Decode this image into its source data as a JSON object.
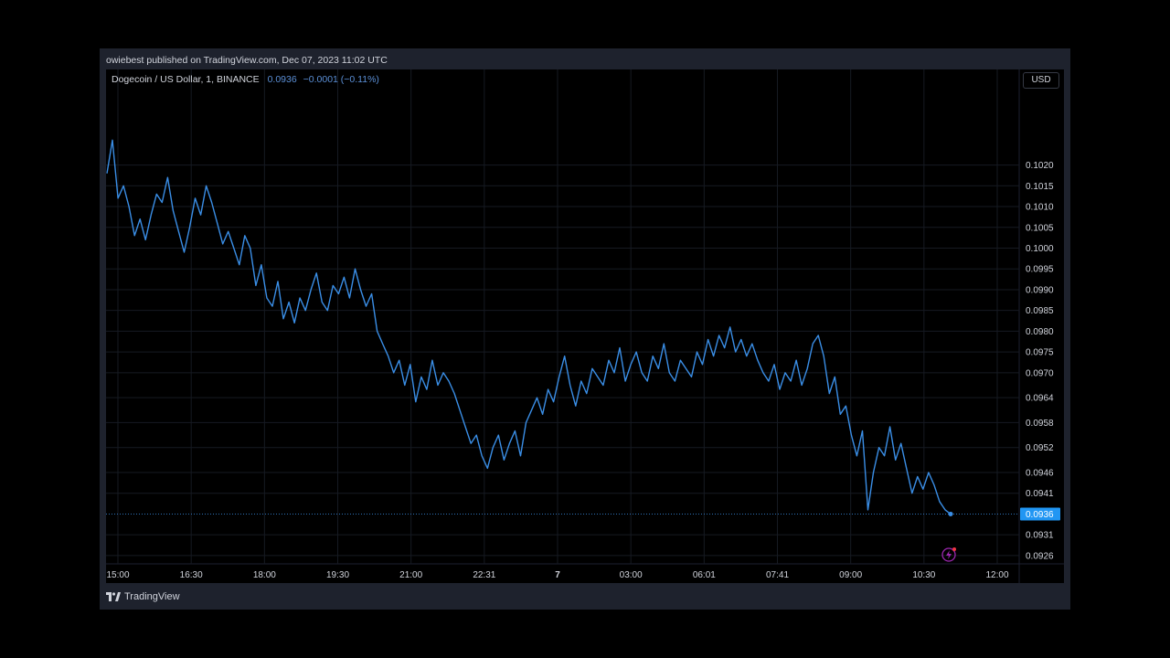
{
  "header": {
    "published": "owiebest published on TradingView.com, Dec 07, 2023 11:02 UTC"
  },
  "legend": {
    "symbol": "Dogecoin / US Dollar, 1, BINANCE",
    "price": "0.0936",
    "change": "−0.0001 (−0.11%)"
  },
  "toolbar": {
    "currency_label": "USD"
  },
  "footer": {
    "brand": "TradingView"
  },
  "colors": {
    "line": "#3a8ee6",
    "last_price_bg": "#2196f3",
    "grid": "#161a22",
    "alert_icon": "#9c27b0"
  },
  "icons": {
    "alert": "lightning-alert-icon",
    "logo": "tradingview-logo-icon"
  },
  "chart_data": {
    "type": "line",
    "title": "Dogecoin / US Dollar, 1, BINANCE",
    "last_price": "0.0936",
    "y_ticks": [
      "0.1020",
      "0.1015",
      "0.1010",
      "0.1005",
      "0.1000",
      "0.0995",
      "0.0990",
      "0.0985",
      "0.0980",
      "0.0975",
      "0.0970",
      "0.0964",
      "0.0958",
      "0.0952",
      "0.0946",
      "0.0941",
      "0.0931",
      "0.0926"
    ],
    "x_ticks": [
      "15:00",
      "16:30",
      "18:00",
      "19:30",
      "21:00",
      "22:31",
      "7",
      "03:00",
      "06:01",
      "07:41",
      "09:00",
      "10:30",
      "12:00"
    ],
    "ylim": [
      0.0924,
      0.1043
    ],
    "grid": true,
    "series": [
      {
        "values": [
          0.1018,
          0.1026,
          0.1012,
          0.1015,
          0.101,
          0.1003,
          0.1007,
          0.1002,
          0.1008,
          0.1013,
          0.1011,
          0.1017,
          0.1009,
          0.1004,
          0.0999,
          0.1005,
          0.1012,
          0.1008,
          0.1015,
          0.1011,
          0.1006,
          0.1001,
          0.1004,
          0.1,
          0.0996,
          0.1003,
          0.1,
          0.0991,
          0.0996,
          0.0988,
          0.0986,
          0.0992,
          0.0983,
          0.0987,
          0.0982,
          0.0988,
          0.0985,
          0.099,
          0.0994,
          0.0987,
          0.0985,
          0.0991,
          0.0989,
          0.0993,
          0.0988,
          0.0995,
          0.099,
          0.0986,
          0.0989,
          0.098,
          0.0977,
          0.0974,
          0.097,
          0.0973,
          0.0967,
          0.0972,
          0.0963,
          0.0969,
          0.0966,
          0.0973,
          0.0967,
          0.097,
          0.0968,
          0.0965,
          0.0961,
          0.0957,
          0.0953,
          0.0955,
          0.095,
          0.0947,
          0.0952,
          0.0955,
          0.0949,
          0.0953,
          0.0956,
          0.095,
          0.0958,
          0.0961,
          0.0964,
          0.096,
          0.0966,
          0.0963,
          0.0969,
          0.0974,
          0.0967,
          0.0962,
          0.0968,
          0.0965,
          0.0971,
          0.0969,
          0.0967,
          0.0973,
          0.097,
          0.0976,
          0.0968,
          0.0972,
          0.0975,
          0.097,
          0.0968,
          0.0974,
          0.0971,
          0.0977,
          0.097,
          0.0968,
          0.0973,
          0.0971,
          0.0969,
          0.0975,
          0.0972,
          0.0978,
          0.0974,
          0.0979,
          0.0976,
          0.0981,
          0.0975,
          0.0978,
          0.0974,
          0.0977,
          0.0973,
          0.097,
          0.0968,
          0.0972,
          0.0966,
          0.097,
          0.0968,
          0.0973,
          0.0967,
          0.0971,
          0.0977,
          0.0979,
          0.0974,
          0.0965,
          0.0969,
          0.096,
          0.0962,
          0.0955,
          0.095,
          0.0956,
          0.0937,
          0.0946,
          0.0952,
          0.095,
          0.0957,
          0.0949,
          0.0953,
          0.0947,
          0.0941,
          0.0945,
          0.0942,
          0.0946,
          0.0943,
          0.0939,
          0.0937,
          0.0936
        ]
      }
    ]
  }
}
